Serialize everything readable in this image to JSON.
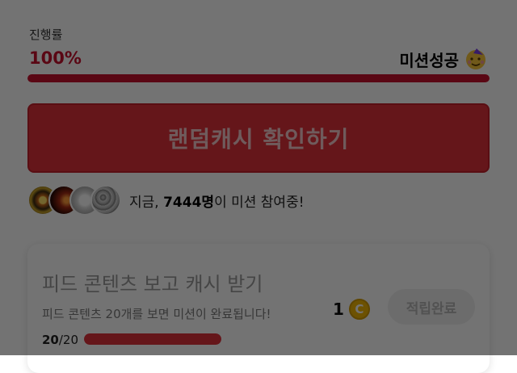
{
  "progress": {
    "label": "진행률",
    "percent_text": "100%",
    "value": 1.0,
    "status": "미션성공",
    "status_icon": "party-face-icon"
  },
  "cta": {
    "label": "랜덤캐시 확인하기"
  },
  "participants": {
    "prefix": "지금, ",
    "count": "7444명",
    "suffix": "이 미션 참여중!"
  },
  "mission_card": {
    "title": "피드 콘텐츠 보고 캐시 받기",
    "description": "피드 콘텐츠 20개를 보면 미션이 완료됩니다!",
    "reward_count": "1",
    "coin_symbol": "C",
    "button_label": "적립완료",
    "count_current": "20",
    "count_separator": "/20",
    "progress_value": 1.0
  },
  "colors": {
    "accent": "#e0313b",
    "progress": "#c8102e"
  }
}
